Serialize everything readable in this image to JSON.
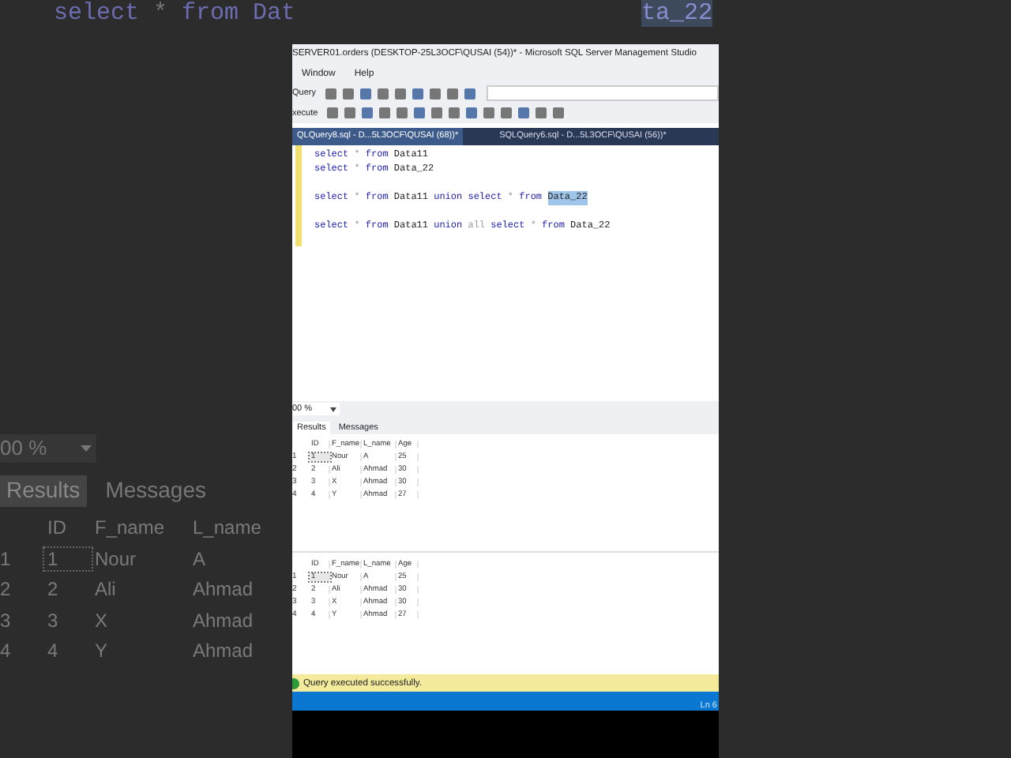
{
  "backdrop": {
    "code": [
      {
        "t": "select",
        "kind": "keyword"
      },
      {
        "t": "*",
        "kind": "op"
      },
      {
        "t": "from",
        "kind": "keyword"
      },
      {
        "t": "Dat",
        "kind": "ident"
      }
    ],
    "code_tail": "ta_22",
    "zoom": "00 %",
    "tabs": [
      {
        "label": "Results",
        "selected": true
      },
      {
        "label": "Messages",
        "selected": false
      }
    ],
    "columns": [
      "ID",
      "F_name",
      "L_name"
    ],
    "rows": [
      {
        "num": "1",
        "cells": [
          "1",
          "Nour",
          "A"
        ],
        "selected": true
      },
      {
        "num": "2",
        "cells": [
          "2",
          "Ali",
          "Ahmad"
        ],
        "selected": false
      },
      {
        "num": "3",
        "cells": [
          "3",
          "X",
          "Ahmad"
        ],
        "selected": false
      },
      {
        "num": "4",
        "cells": [
          "4",
          "Y",
          "Ahmad"
        ],
        "selected": false
      }
    ]
  },
  "window": {
    "title": "SERVER01.orders (DESKTOP-25L3OCF\\QUSAI (54))* - Microsoft SQL Server Management Studio",
    "menu": [
      "Window",
      "Help"
    ],
    "toolbars": [
      {
        "label": "Query"
      },
      {
        "label": "xecute"
      }
    ],
    "doc_tabs": [
      {
        "label": "QLQuery8.sql - D...5L3OCF\\QUSAI (68))*",
        "selected": true
      },
      {
        "label": "SQLQuery6.sql - D...5L3OCF\\QUSAI (56))*",
        "selected": false
      }
    ],
    "editor": {
      "lines": [
        {
          "kind": "code",
          "tokens": [
            {
              "t": "select",
              "kind": "keyword"
            },
            {
              "t": "*",
              "kind": "op"
            },
            {
              "t": "from",
              "kind": "keyword"
            },
            {
              "t": "Data11",
              "kind": "ident"
            }
          ]
        },
        {
          "kind": "code",
          "tokens": [
            {
              "t": "select",
              "kind": "keyword"
            },
            {
              "t": "*",
              "kind": "op"
            },
            {
              "t": "from",
              "kind": "keyword"
            },
            {
              "t": "Data_22",
              "kind": "ident"
            }
          ]
        },
        {
          "kind": "blank"
        },
        {
          "kind": "code",
          "tokens": [
            {
              "t": "select",
              "kind": "keyword"
            },
            {
              "t": "*",
              "kind": "op"
            },
            {
              "t": "from",
              "kind": "keyword"
            },
            {
              "t": "Data11",
              "kind": "ident"
            },
            {
              "t": "union",
              "kind": "keyword"
            },
            {
              "t": "select",
              "kind": "keyword"
            },
            {
              "t": "*",
              "kind": "op"
            },
            {
              "t": "from",
              "kind": "keyword"
            },
            {
              "t": "Data_22",
              "kind": "highlight"
            }
          ]
        },
        {
          "kind": "blank"
        },
        {
          "kind": "code",
          "tokens": [
            {
              "t": "select",
              "kind": "keyword"
            },
            {
              "t": "*",
              "kind": "op"
            },
            {
              "t": "from",
              "kind": "keyword"
            },
            {
              "t": "Data11",
              "kind": "ident"
            },
            {
              "t": "union",
              "kind": "keyword"
            },
            {
              "t": "all",
              "kind": "op"
            },
            {
              "t": "select",
              "kind": "keyword"
            },
            {
              "t": "*",
              "kind": "op"
            },
            {
              "t": "from",
              "kind": "keyword"
            },
            {
              "t": "Data_22",
              "kind": "ident"
            }
          ]
        }
      ]
    },
    "zoom": "00 %",
    "result_tabs": [
      {
        "label": "Results",
        "selected": true
      },
      {
        "label": "Messages",
        "selected": false
      }
    ],
    "grids": [
      {
        "columns": [
          "ID",
          "F_name",
          "L_name",
          "Age"
        ],
        "rows": [
          {
            "num": "1",
            "cells": [
              "1",
              "Nour",
              "A",
              "25"
            ],
            "selected": true
          },
          {
            "num": "2",
            "cells": [
              "2",
              "Ali",
              "Ahmad",
              "30"
            ],
            "selected": false
          },
          {
            "num": "3",
            "cells": [
              "3",
              "X",
              "Ahmad",
              "30"
            ],
            "selected": false
          },
          {
            "num": "4",
            "cells": [
              "4",
              "Y",
              "Ahmad",
              "27"
            ],
            "selected": false
          }
        ]
      },
      {
        "columns": [
          "ID",
          "F_name",
          "L_name",
          "Age"
        ],
        "rows": [
          {
            "num": "1",
            "cells": [
              "1",
              "Nour",
              "A",
              "25"
            ],
            "selected": true
          },
          {
            "num": "2",
            "cells": [
              "2",
              "Ali",
              "Ahmad",
              "30"
            ],
            "selected": false
          },
          {
            "num": "3",
            "cells": [
              "3",
              "X",
              "Ahmad",
              "30"
            ],
            "selected": false
          },
          {
            "num": "4",
            "cells": [
              "4",
              "Y",
              "Ahmad",
              "27"
            ],
            "selected": false
          }
        ]
      }
    ],
    "status": {
      "message": "Query executed successfully.",
      "position": "Ln 6"
    }
  }
}
